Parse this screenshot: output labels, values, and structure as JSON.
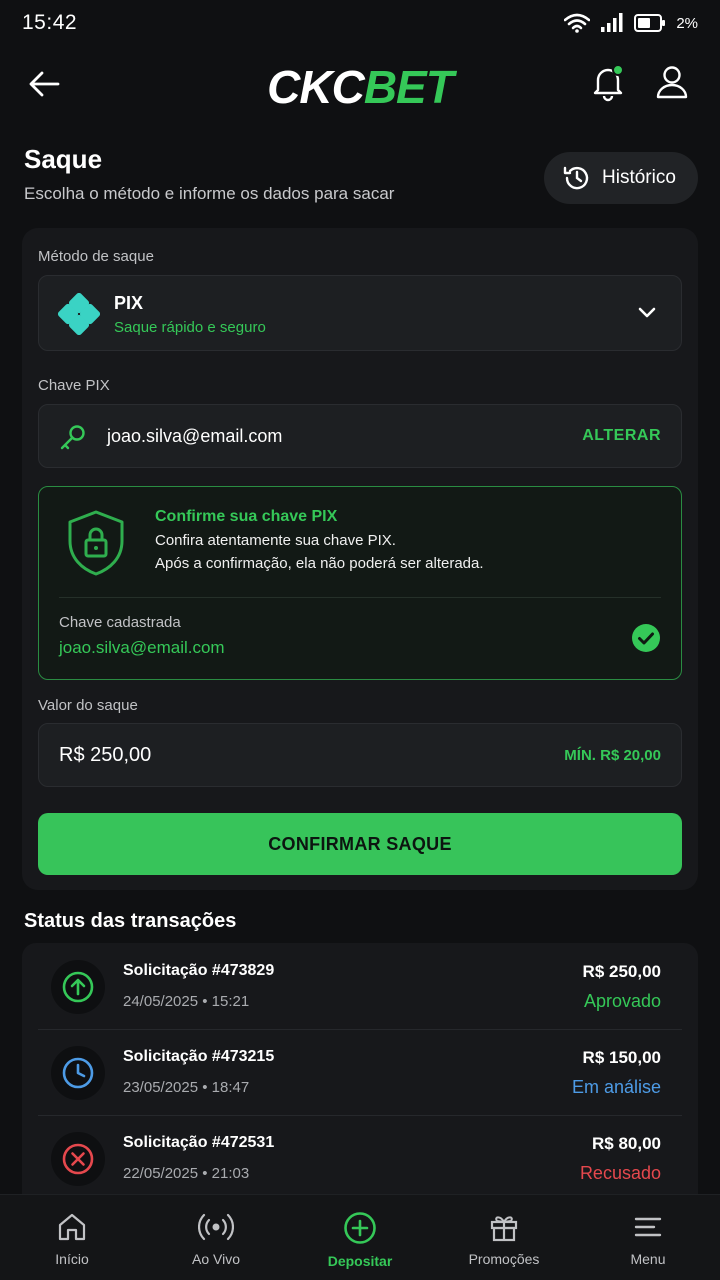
{
  "status_bar": {
    "time": "15:42",
    "battery": "2%"
  },
  "header": {
    "logo_left": "CKC",
    "logo_right": "BET"
  },
  "page": {
    "title": "Saque",
    "subtitle": "Escolha o método e informe os dados para sacar",
    "history_label": "Histórico"
  },
  "form": {
    "method_label": "Método de saque",
    "method_name": "PIX",
    "method_sub": "Saque rápido e seguro",
    "key_label": "Chave PIX",
    "key_value": "joao.silva@email.com",
    "key_action": "ALTERAR",
    "confirm_title": "Confirme sua chave PIX",
    "confirm_line1": "Confira atentamente sua chave PIX.",
    "confirm_line2": "Após a confirmação, ela não poderá ser alterada.",
    "registered_label": "Chave cadastrada",
    "registered_value": "joao.silva@email.com",
    "amount_label": "Valor do saque",
    "amount_value": "R$ 250,00",
    "amount_min": "MÍN. R$ 20,00",
    "submit_label": "CONFIRMAR SAQUE"
  },
  "transactions": {
    "title": "Status das transações",
    "items": [
      {
        "title": "Solicitação #473829",
        "date": "24/05/2025 • 15:21",
        "amount": "R$ 250,00",
        "status": "Aprovado",
        "icon": "arrow-up-circle-icon",
        "color": "#35c858"
      },
      {
        "title": "Solicitação #473215",
        "date": "23/05/2025 • 18:47",
        "amount": "R$ 150,00",
        "status": "Em análise",
        "icon": "clock-icon",
        "color": "#4d9be6"
      },
      {
        "title": "Solicitação #472531",
        "date": "22/05/2025 • 21:03",
        "amount": "R$ 80,00",
        "status": "Recusado",
        "icon": "x-circle-icon",
        "color": "#e5484d"
      }
    ]
  },
  "bottom_nav": {
    "items": [
      {
        "label": "Início",
        "icon": "home-icon"
      },
      {
        "label": "Ao Vivo",
        "icon": "live-icon"
      },
      {
        "label": "Depositar",
        "icon": "plus-circle-icon",
        "active": true
      },
      {
        "label": "Promoções",
        "icon": "gift-icon"
      },
      {
        "label": "Menu",
        "icon": "menu-icon"
      }
    ]
  },
  "colors": {
    "accent": "#35c858",
    "background": "#0f1012",
    "card": "#17181b",
    "pending": "#4d9be6",
    "rejected": "#e5484d"
  }
}
